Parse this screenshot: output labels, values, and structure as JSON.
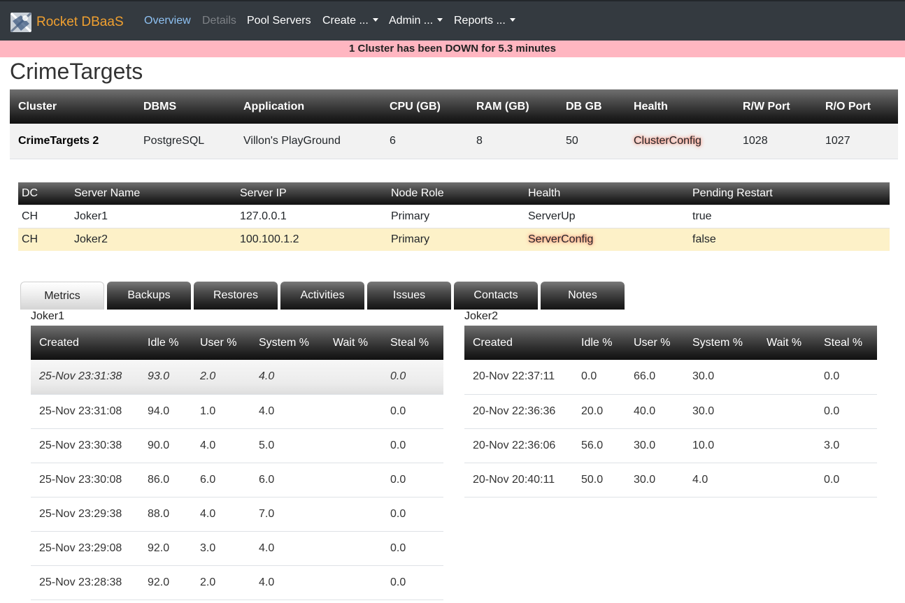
{
  "navbar": {
    "brand": "Rocket DBaaS",
    "links": {
      "overview": "Overview",
      "details": "Details",
      "pool_servers": "Pool Servers",
      "create": "Create ...",
      "admin": "Admin ...",
      "reports": "Reports ..."
    }
  },
  "alert": "1 Cluster has been DOWN for 5.3 minutes",
  "page_title": "CrimeTargets",
  "cluster_table": {
    "headers": [
      "Cluster",
      "DBMS",
      "Application",
      "CPU (GB)",
      "RAM (GB)",
      "DB GB",
      "Health",
      "R/W Port",
      "R/O Port"
    ],
    "row": [
      "CrimeTargets 2",
      "PostgreSQL",
      "Villon's PlayGround",
      "6",
      "8",
      "50",
      "ClusterConfig",
      "1028",
      "1027"
    ]
  },
  "server_table": {
    "headers": [
      "DC",
      "Server Name",
      "Server IP",
      "Node Role",
      "Health",
      "Pending Restart"
    ],
    "rows": [
      [
        "CH",
        "Joker1",
        "127.0.0.1",
        "Primary",
        "ServerUp",
        "true"
      ],
      [
        "CH",
        "Joker2",
        "100.100.1.2",
        "Primary",
        "ServerConfig",
        "false"
      ]
    ]
  },
  "tabs": [
    "Metrics",
    "Backups",
    "Restores",
    "Activities",
    "Issues",
    "Contacts",
    "Notes"
  ],
  "metrics": {
    "headers": [
      "Created",
      "Idle %",
      "User %",
      "System %",
      "Wait %",
      "Steal %"
    ],
    "joker1": {
      "title": "Joker1",
      "rows": [
        [
          "25-Nov 23:31:38",
          "93.0",
          "2.0",
          "4.0",
          "",
          "0.0"
        ],
        [
          "25-Nov 23:31:08",
          "94.0",
          "1.0",
          "4.0",
          "",
          "0.0"
        ],
        [
          "25-Nov 23:30:38",
          "90.0",
          "4.0",
          "5.0",
          "",
          "0.0"
        ],
        [
          "25-Nov 23:30:08",
          "86.0",
          "6.0",
          "6.0",
          "",
          "0.0"
        ],
        [
          "25-Nov 23:29:38",
          "88.0",
          "4.0",
          "7.0",
          "",
          "0.0"
        ],
        [
          "25-Nov 23:29:08",
          "92.0",
          "3.0",
          "4.0",
          "",
          "0.0"
        ],
        [
          "25-Nov 23:28:38",
          "92.0",
          "2.0",
          "4.0",
          "",
          "0.0"
        ]
      ]
    },
    "joker2": {
      "title": "Joker2",
      "rows": [
        [
          "20-Nov 22:37:11",
          "0.0",
          "66.0",
          "30.0",
          "",
          "0.0"
        ],
        [
          "20-Nov 22:36:36",
          "20.0",
          "40.0",
          "30.0",
          "",
          "0.0"
        ],
        [
          "20-Nov 22:36:06",
          "56.0",
          "30.0",
          "10.0",
          "",
          "3.0"
        ],
        [
          "20-Nov 20:40:11",
          "50.0",
          "30.0",
          "4.0",
          "",
          "0.0"
        ]
      ]
    }
  },
  "colors": {
    "navbar": "#343a40",
    "brand": "#f0a030",
    "active_link": "#8ec1f2",
    "alert_bg": "#ffb6c1",
    "warn_row": "#fdf1c8",
    "health_glow": "#ff6a4d"
  },
  "icons": {
    "brand_logo": "rocket-dbaas-logo-icon",
    "dropdown": "caret-down-icon"
  }
}
